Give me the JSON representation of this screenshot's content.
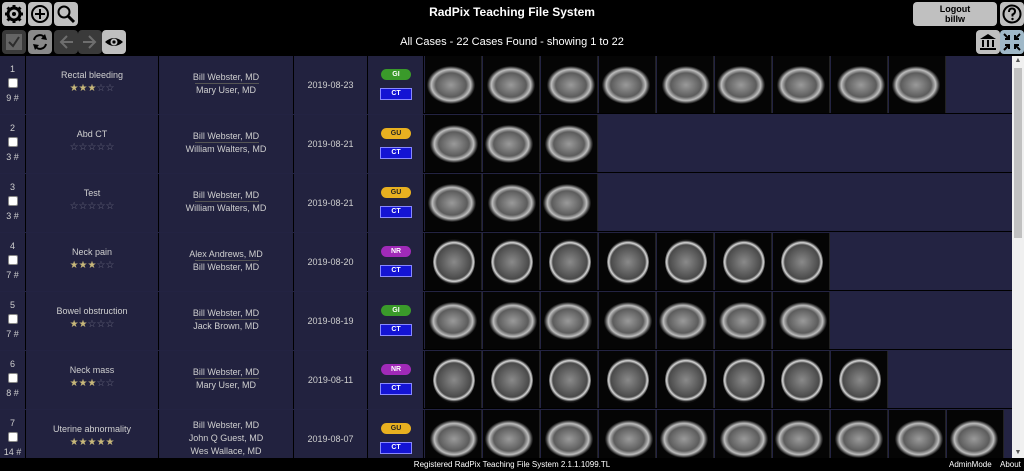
{
  "app": {
    "title": "RadPix Teaching File System",
    "subtitle": "All Cases - 22 Cases Found - showing 1 to 22",
    "logout_label": "Logout",
    "username": "billw"
  },
  "toolbar": {
    "icons": [
      "gear-icon",
      "add-icon",
      "search-icon",
      "check-icon",
      "refresh-icon",
      "back-arrow-icon",
      "forward-arrow-icon",
      "eye-icon",
      "museum-icon",
      "collapse-icon",
      "help-icon"
    ]
  },
  "cases": [
    {
      "num": "1",
      "count": "9 #",
      "title": "Rectal bleeding",
      "stars": 3,
      "authors": [
        "Bill Webster, MD",
        "Mary User, MD"
      ],
      "date": "2019-08-23",
      "system": "GI",
      "modality": "CT",
      "thumb_count": 9
    },
    {
      "num": "2",
      "count": "3 #",
      "title": "Abd CT",
      "stars": 0,
      "authors": [
        "Bill Webster, MD",
        "William Walters, MD"
      ],
      "date": "2019-08-21",
      "system": "GU",
      "modality": "CT",
      "thumb_count": 3
    },
    {
      "num": "3",
      "count": "3 #",
      "title": "Test",
      "stars": 0,
      "authors": [
        "Bill Webster, MD",
        "William Walters, MD"
      ],
      "date": "2019-08-21",
      "system": "GU",
      "modality": "CT",
      "thumb_count": 3
    },
    {
      "num": "4",
      "count": "7 #",
      "title": "Neck pain",
      "stars": 3,
      "authors": [
        "Alex Andrews, MD",
        "Bill Webster, MD"
      ],
      "date": "2019-08-20",
      "system": "NR",
      "modality": "CT",
      "thumb_count": 7
    },
    {
      "num": "5",
      "count": "7 #",
      "title": "Bowel obstruction",
      "stars": 2,
      "authors": [
        "Bill Webster, MD",
        "Jack Brown, MD"
      ],
      "date": "2019-08-19",
      "system": "GI",
      "modality": "CT",
      "thumb_count": 7
    },
    {
      "num": "6",
      "count": "8 #",
      "title": "Neck mass",
      "stars": 3,
      "authors": [
        "Bill Webster, MD",
        "Mary User, MD"
      ],
      "date": "2019-08-11",
      "system": "NR",
      "modality": "CT",
      "thumb_count": 8
    },
    {
      "num": "7",
      "count": "14 #",
      "title": "Uterine abnormality",
      "stars": 5,
      "authors": [
        "Bill Webster, MD",
        "John Q Guest, MD",
        "Wes Wallace, MD"
      ],
      "date": "2019-08-07",
      "system": "GU",
      "modality": "CT",
      "thumb_count": 10
    }
  ],
  "footer": {
    "registration": "Registered RadPix Teaching File System 2.1.1.1099.TL",
    "admin_mode": "AdminMode",
    "about": "About"
  }
}
